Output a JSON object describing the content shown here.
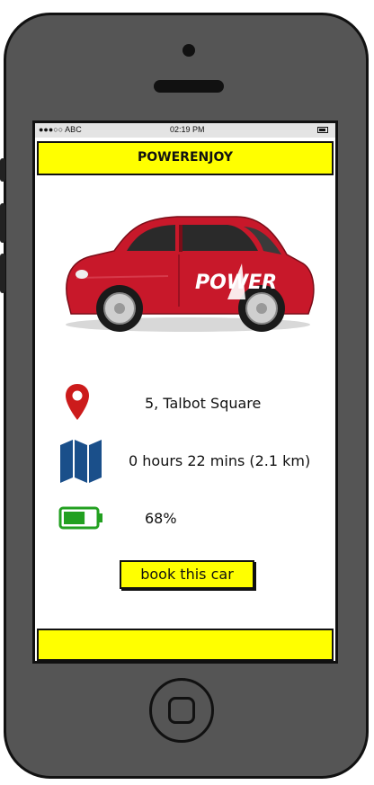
{
  "status_bar": {
    "carrier": "●●●○○ ABC",
    "time": "02:19 PM"
  },
  "header": {
    "title": "POWERENJOY"
  },
  "car": {
    "brand_text": "POWER",
    "body_color": "#c8182a"
  },
  "info": {
    "location": "5, Talbot Square",
    "travel": "0 hours 22 mins (2.1 km)",
    "battery_percent": "68%",
    "battery_level": 0.68
  },
  "actions": {
    "book_label": "book this car"
  },
  "icons": {
    "location": "map-pin-icon",
    "route": "map-icon",
    "battery": "battery-icon"
  },
  "colors": {
    "accent": "#ffff00",
    "pin": "#cc1b1b",
    "map": "#1a4f8a",
    "battery": "#22a020"
  }
}
